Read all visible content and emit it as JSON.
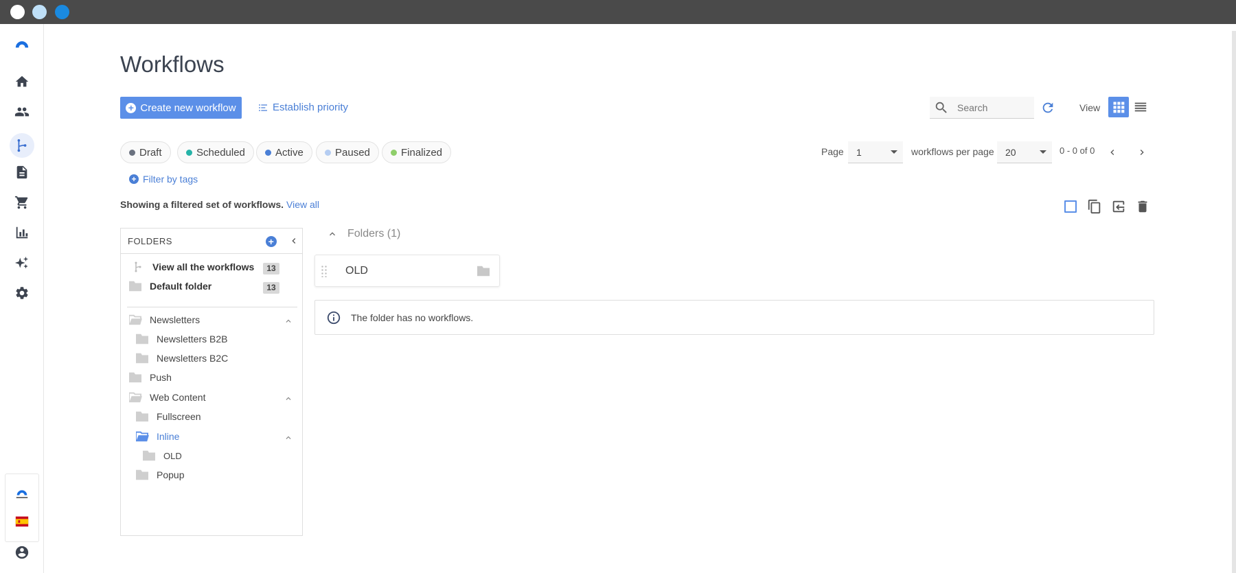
{
  "window": {
    "dots": [
      "#ffffff",
      "#bfe0f8",
      "#1a8ae0"
    ]
  },
  "sidebar": {
    "items": [
      "logo-icon",
      "home-icon",
      "contacts-icon",
      "workflows-icon",
      "documents-icon",
      "cart-icon",
      "reports-icon",
      "sparkle-icon",
      "settings-icon"
    ],
    "bottom": [
      "connectif-logo-icon",
      "spain-flag-icon",
      "account-icon"
    ]
  },
  "page": {
    "title": "Workflows"
  },
  "toolbar": {
    "create_label": "Create new workflow",
    "priority_label": "Establish priority",
    "search_placeholder": "Search",
    "view_label": "View"
  },
  "filters": {
    "chips": [
      {
        "label": "Draft",
        "color": "#6b7280"
      },
      {
        "label": "Scheduled",
        "color": "#26b3a8"
      },
      {
        "label": "Active",
        "color": "#4a7fd6"
      },
      {
        "label": "Paused",
        "color": "#b5cdf2"
      },
      {
        "label": "Finalized",
        "color": "#8fce6a"
      }
    ],
    "tags_label": "Filter by tags",
    "showing_text": "Showing a filtered set of workflows.",
    "view_all_label": "View all"
  },
  "pager": {
    "page_label": "Page",
    "page_value": "1",
    "per_page_label": "workflows per page",
    "per_page_value": "20",
    "range_text": "0 - 0 of 0"
  },
  "folders_panel": {
    "title": "FOLDERS",
    "view_all": {
      "label": "View all the workflows",
      "count": "13"
    },
    "default": {
      "label": "Default folder",
      "count": "13"
    },
    "tree": [
      {
        "label": "Newsletters"
      },
      {
        "label": "Newsletters B2B"
      },
      {
        "label": "Newsletters B2C"
      },
      {
        "label": "Push"
      },
      {
        "label": "Web Content"
      },
      {
        "label": "Fullscreen"
      },
      {
        "label": "Inline"
      },
      {
        "label": "OLD"
      },
      {
        "label": "Popup"
      }
    ]
  },
  "content": {
    "folders_header": "Folders (1)",
    "folder_card_name": "OLD",
    "empty_message": "The folder has no workflows."
  }
}
